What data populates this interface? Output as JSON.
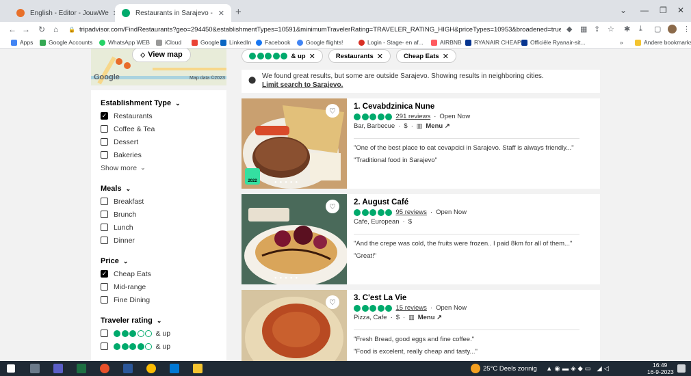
{
  "browser": {
    "tabs": [
      {
        "title": "English - Editor - JouwWeb",
        "favicon_color": "#e8702a"
      },
      {
        "title": "Restaurants in Sarajevo - Tripadv",
        "favicon_color": "#00aa6c"
      }
    ],
    "url": "tripadvisor.com/FindRestaurants?geo=294450&establishmentTypes=10591&minimumTravelerRating=TRAVELER_RATING_HIGH&priceTypes=10953&broadened=true",
    "bookmarks": [
      "Apps",
      "Google Accounts",
      "WhatsApp WEB",
      "iCloud",
      "Google",
      "LinkedIn",
      "Facebook",
      "Google flights!",
      "Login - Stage- en af...",
      "AIRBNB",
      "RYANAIR CHEAP",
      "Officiële Ryanair-sit...",
      "»",
      "Andere bookmarks"
    ]
  },
  "map": {
    "view_label": "View map",
    "logo": "Google",
    "data_label": "Map data ©2023"
  },
  "chips": [
    {
      "label": "& up",
      "bubbles": 5
    },
    {
      "label": "Restaurants"
    },
    {
      "label": "Cheap Eats"
    }
  ],
  "banner": {
    "text": "We found great results, but some are outside Sarajevo. Showing results in neighboring cities.",
    "link": "Limit search to Sarajevo."
  },
  "filters": {
    "establishment": {
      "title": "Establishment Type",
      "items": [
        {
          "label": "Restaurants",
          "checked": true
        },
        {
          "label": "Coffee & Tea",
          "checked": false
        },
        {
          "label": "Dessert",
          "checked": false
        },
        {
          "label": "Bakeries",
          "checked": false
        }
      ],
      "show_more": "Show more"
    },
    "meals": {
      "title": "Meals",
      "items": [
        {
          "label": "Breakfast",
          "checked": false
        },
        {
          "label": "Brunch",
          "checked": false
        },
        {
          "label": "Lunch",
          "checked": false
        },
        {
          "label": "Dinner",
          "checked": false
        }
      ]
    },
    "price": {
      "title": "Price",
      "items": [
        {
          "label": "Cheap Eats",
          "checked": true
        },
        {
          "label": "Mid-range",
          "checked": false
        },
        {
          "label": "Fine Dining",
          "checked": false
        }
      ]
    },
    "rating": {
      "title": "Traveler rating",
      "items": [
        {
          "label": "& up",
          "bubbles": 3
        },
        {
          "label": "& up",
          "bubbles": 4
        }
      ]
    }
  },
  "restaurants": [
    {
      "name": "1. Cevabdzinica Nune",
      "reviews": "291 reviews",
      "status": "Open Now",
      "cuisine": "Bar, Barbecue",
      "price": "$",
      "menu": "Menu",
      "badge": "2022",
      "quotes": [
        "\"One of the best place to eat cevapcici in Sarajevo. Staff is always friendly...\"",
        "\"Traditional food in Sarajevo\""
      ]
    },
    {
      "name": "2. August Café",
      "reviews": "95 reviews",
      "status": "Open Now",
      "cuisine": "Cafe, European",
      "price": "$",
      "menu": "",
      "quotes": [
        "\"And the crepe was cold, the fruits were frozen.. I paid 8km for all of them...\"",
        "\"Great!\""
      ]
    },
    {
      "name": "3. C'est La Vie",
      "reviews": "15 reviews",
      "status": "Open Now",
      "cuisine": "Pizza, Cafe",
      "price": "$",
      "menu": "Menu",
      "quotes": [
        "\"Fresh Bread, good eggs and fine coffee.\"",
        "\"Food is excelent, really cheap and tasty...\""
      ]
    }
  ],
  "taskbar": {
    "weather": "25°C Deels zonnig",
    "time": "16:49",
    "date": "16-9-2023"
  }
}
